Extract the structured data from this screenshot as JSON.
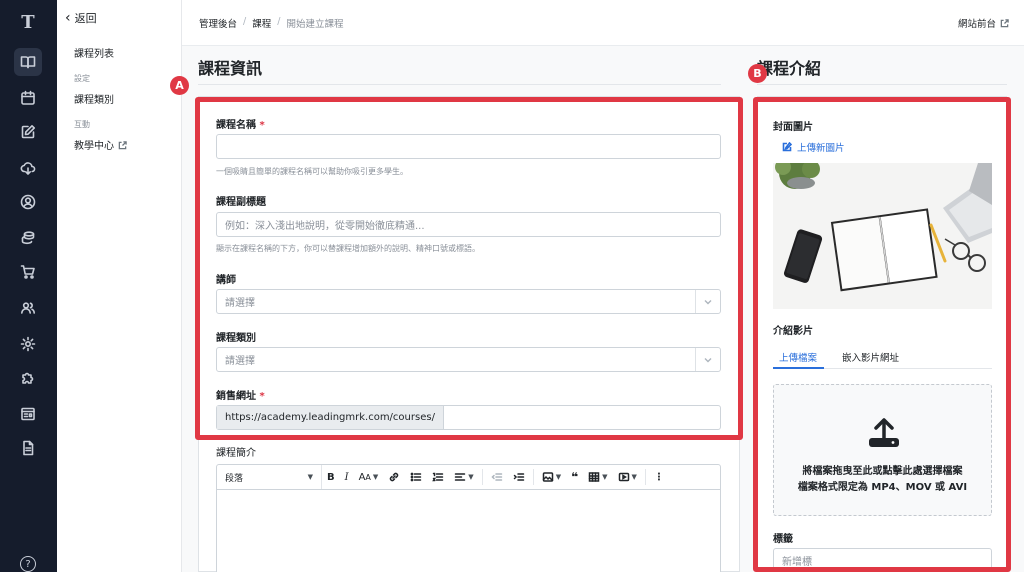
{
  "rail": {
    "logo": "T",
    "icons": [
      "book-icon",
      "calendar-icon",
      "edit-icon",
      "cloud-download-icon",
      "user-circle-icon",
      "coins-icon",
      "cart-icon",
      "users-icon",
      "gear-icon",
      "puzzle-icon",
      "layout-icon",
      "document-icon",
      "help-icon"
    ],
    "help_glyph": "?"
  },
  "subnav": {
    "back": "返回",
    "course_list": "課程列表",
    "section_settings": "設定",
    "course_category": "課程類別",
    "section_interaction": "互動",
    "teaching_center": "教學中心"
  },
  "topbar": {
    "breadcrumb": [
      "管理後台",
      "課程",
      "開始建立課程"
    ],
    "separator": "/",
    "site_front": "網站前台"
  },
  "course_info": {
    "title": "課程資訊",
    "badge": "A",
    "name_label": "課程名稱",
    "required_mark": "*",
    "name_value": "",
    "name_help": "一個吸睛且簡單的課程名稱可以幫助你吸引更多學生。",
    "subtitle_label": "課程副標題",
    "subtitle_placeholder": "例如：深入淺出地說明，從零開始徹底精通...",
    "subtitle_help": "顯示在課程名稱的下方，你可以替課程增加額外的說明、精神口號或標語。",
    "instructor_label": "講師",
    "instructor_value": "請選擇",
    "category_label": "課程類別",
    "category_value": "請選擇",
    "sales_url_label": "銷售網址",
    "sales_url_prefix": "https://academy.leadingmrk.com/courses/",
    "sales_url_value": "",
    "intro_label": "課程簡介",
    "editor_paragraph": "段落"
  },
  "course_intro": {
    "title": "課程介紹",
    "badge": "B",
    "cover_label": "封面圖片",
    "upload_new_image": "上傳新圖片",
    "video_label": "介紹影片",
    "tabs": [
      "上傳檔案",
      "嵌入影片網址"
    ],
    "active_tab": "上傳檔案",
    "drop_line1": "將檔案拖曳至此或點擊此處選擇檔案",
    "drop_line2": "檔案格式限定為 MP4、MOV 或 AVI",
    "tags_label": "標籤",
    "tags_placeholder": "新增標"
  },
  "colors": {
    "rail_bg": "#151c2c",
    "highlight_red": "#e03844",
    "link_blue": "#2a6fdb",
    "required_red": "#dc3545"
  }
}
